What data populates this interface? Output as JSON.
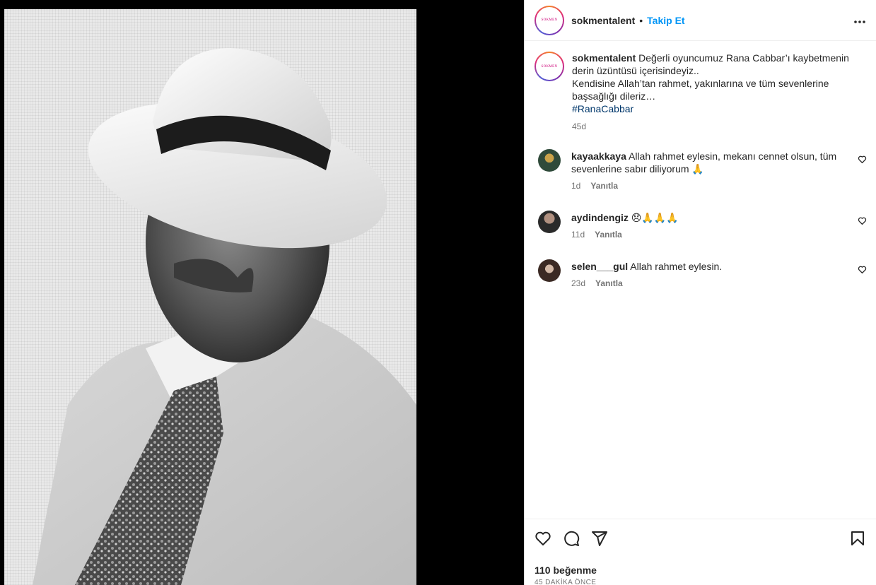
{
  "header": {
    "username": "sokmentalent",
    "dot": "•",
    "follow_label": "Takip Et",
    "more_icon": "more-horizontal-icon",
    "avatar_text": "SOKMEN"
  },
  "caption": {
    "username": "sokmentalent",
    "text_line1": " Değerli oyuncumuz Rana Cabbar’ı kaybetmenin derin üzüntüsü içerisindeyiz..",
    "text_line2": "Kendisine Allah’tan rahmet, yakınlarına ve tüm sevenlerine başsağlığı dileriz…",
    "hashtag": "#RanaCabbar",
    "time": "45d"
  },
  "comments": [
    {
      "username": "kayaakkaya",
      "text": " Allah rahmet eylesin, mekanı cennet olsun, tüm sevenlerine sabır diliyorum 🙏",
      "time": "1d",
      "reply": "Yanıtla"
    },
    {
      "username": "aydindengiz",
      "text": " 😞🙏🙏🙏",
      "time": "11d",
      "reply": "Yanıtla"
    },
    {
      "username": "selen___gul",
      "text": " Allah rahmet eylesin.",
      "time": "23d",
      "reply": "Yanıtla"
    }
  ],
  "actions": {
    "likes": "110 beğenme",
    "time_ago": "45 DAKİKA ÖNCE"
  },
  "colors": {
    "follow_blue": "#0095f6",
    "hashtag_blue": "#00376b",
    "meta_gray": "#737373"
  }
}
